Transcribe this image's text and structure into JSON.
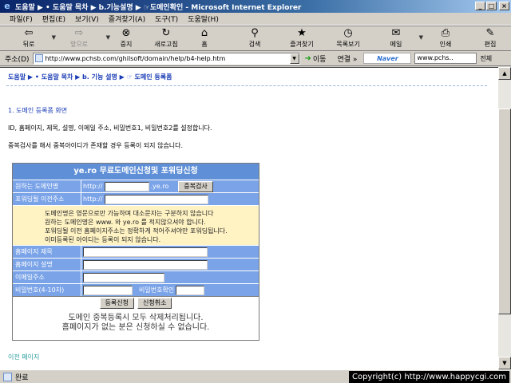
{
  "window": {
    "title": "도움말 ▶ • 도움말 목차 ▶ b.기능설명 ▶ ☞도메인확인 - Microsoft Internet Explorer"
  },
  "menu": [
    "파일(F)",
    "편집(E)",
    "보기(V)",
    "즐겨찾기(A)",
    "도구(T)",
    "도움말(H)"
  ],
  "toolbar": {
    "back": "뒤로",
    "forward": "앞으로",
    "stop": "중지",
    "refresh": "새로고침",
    "home": "홈",
    "search": "검색",
    "favorites": "즐겨찾기",
    "history": "목록보기",
    "mail": "메일",
    "print": "인쇄",
    "edit": "편집"
  },
  "address": {
    "label": "주소(D)",
    "url": "http://www.pchsb.com/ghilsoft/domain/help/b4-help.htm",
    "go": "이동",
    "links": "연결 »",
    "naver": "Naver",
    "search_value": "www.pchs..",
    "search_label": "전체"
  },
  "page": {
    "breadcrumb": [
      "도움말",
      "• 도움말 목차",
      "b. 기능 설명",
      "☞ 도메인 등록폼"
    ],
    "heading": "1. 도메인 등록폼 화면",
    "line1": "ID, 홈페이지, 제목, 설명, 이메일 주소, 비밀번호1, 비밀번호2를 설정합니다.",
    "line2": "중복검사를 해서 중복아이디가 존재할 경우 등록이 되지 않습니다.",
    "prev": "이전 페이지"
  },
  "form": {
    "title": "ye.ro 무료도메인신청및 포워딩신청",
    "domain_label": "원하는 도메인명",
    "http": "http://",
    "suffix": ".ye.ro",
    "dup_button": "중복검사",
    "forward_label": "포워딩될 이전주소",
    "notice": [
      "도메인명은 영문으로만 가능하며 대소문자는 구분하지 않습니다",
      "원하는 도메인명은 www.  와 ye.ro 를 적지않으셔야 합니다.",
      "포워딩될 이전 홈페이지주소는 정확하게 적어주셔야만 포워딩됩니다.",
      "이미등록된 아이디는 등록이 되지 않습니다."
    ],
    "hp_title_label": "홈페이지 제목",
    "hp_desc_label": "홈페이지 설명",
    "email_label": "이메일주소",
    "pw_label": "비밀번호(4-10자)",
    "pw_confirm_label": "비밀번호확인",
    "submit": "등록신청",
    "cancel": "신청취소",
    "bottom1": "도메인 중복등록시 모두 삭제처리됩니다.",
    "bottom2": "홈페이지가 없는 분은 신청하실 수 없습니다."
  },
  "status": {
    "text": "완료",
    "copyright": "Copyright(c) http://www.happycgi.com"
  }
}
